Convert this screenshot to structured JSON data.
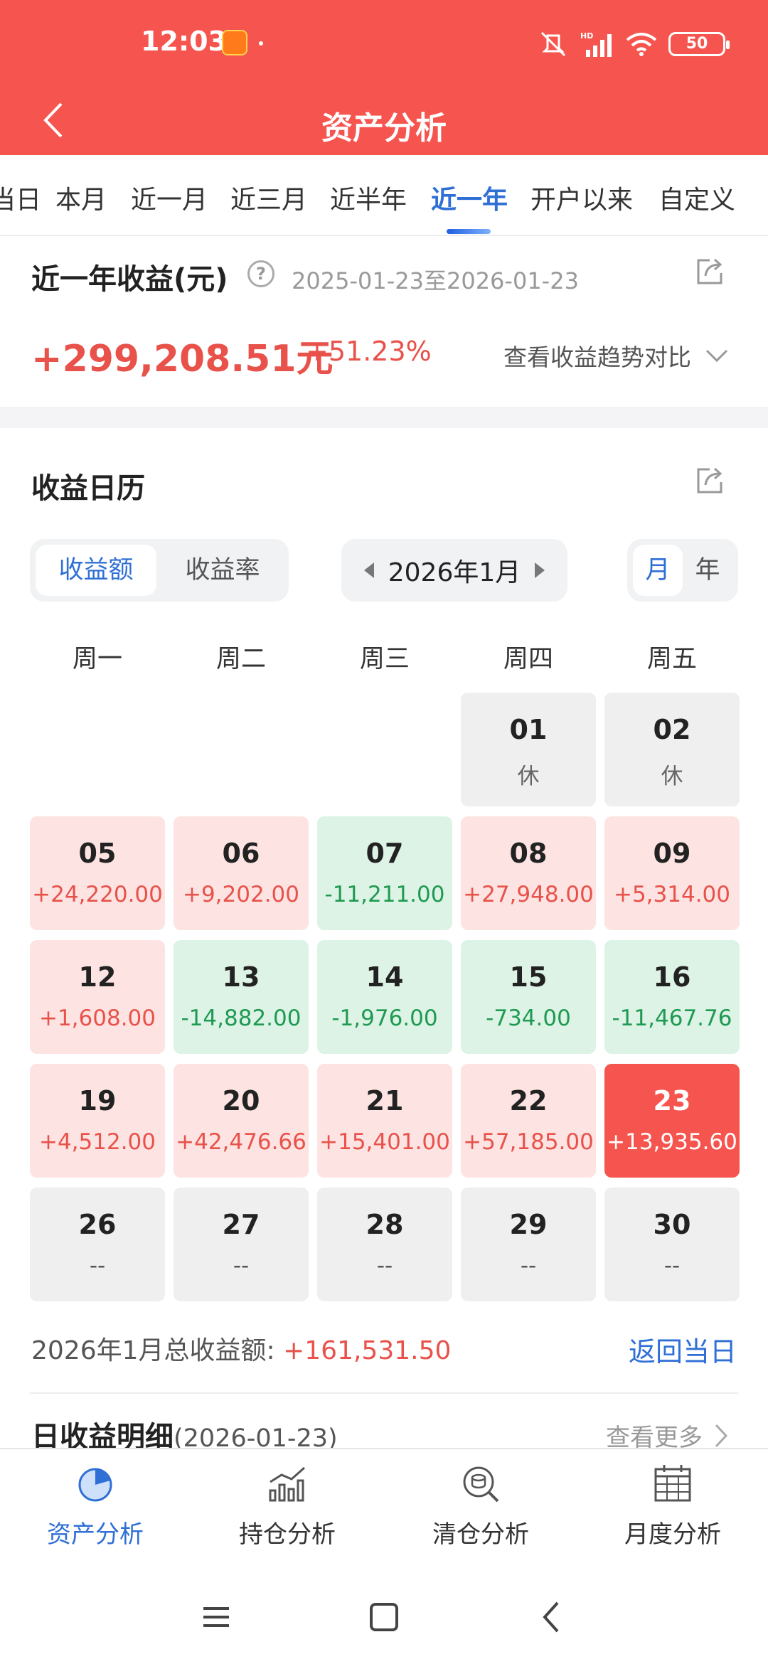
{
  "status": {
    "time": "12:03",
    "battery": "50"
  },
  "nav": {
    "title": "资产分析"
  },
  "period_tabs": [
    "当日",
    "本月",
    "近一月",
    "近三月",
    "近半年",
    "近一年",
    "开户以来",
    "自定义"
  ],
  "summary": {
    "title": "近一年收益(元)",
    "help": "?",
    "range": "2025-01-23至2026-01-23",
    "profit": "+299,208.51元",
    "rate": "+51.23%",
    "trend_link": "查看收益趋势对比"
  },
  "calendar": {
    "title": "收益日历",
    "metric_tabs": [
      "收益额",
      "收益率"
    ],
    "month_label": "2026年1月",
    "view_tabs": [
      "月",
      "年"
    ],
    "weekdays": [
      "周一",
      "周二",
      "周三",
      "周四",
      "周五"
    ],
    "rows": [
      [
        {
          "day": "",
          "value": "",
          "kind": "none"
        },
        {
          "day": "",
          "value": "",
          "kind": "none"
        },
        {
          "day": "",
          "value": "",
          "kind": "none"
        },
        {
          "day": "01",
          "value": "休",
          "kind": "rest"
        },
        {
          "day": "02",
          "value": "休",
          "kind": "rest"
        }
      ],
      [
        {
          "day": "05",
          "value": "+24,220.00",
          "kind": "up"
        },
        {
          "day": "06",
          "value": "+9,202.00",
          "kind": "up"
        },
        {
          "day": "07",
          "value": "-11,211.00",
          "kind": "down"
        },
        {
          "day": "08",
          "value": "+27,948.00",
          "kind": "up"
        },
        {
          "day": "09",
          "value": "+5,314.00",
          "kind": "up"
        }
      ],
      [
        {
          "day": "12",
          "value": "+1,608.00",
          "kind": "up"
        },
        {
          "day": "13",
          "value": "-14,882.00",
          "kind": "down"
        },
        {
          "day": "14",
          "value": "-1,976.00",
          "kind": "down"
        },
        {
          "day": "15",
          "value": "-734.00",
          "kind": "down"
        },
        {
          "day": "16",
          "value": "-11,467.76",
          "kind": "down"
        }
      ],
      [
        {
          "day": "19",
          "value": "+4,512.00",
          "kind": "up"
        },
        {
          "day": "20",
          "value": "+42,476.66",
          "kind": "up"
        },
        {
          "day": "21",
          "value": "+15,401.00",
          "kind": "up"
        },
        {
          "day": "22",
          "value": "+57,185.00",
          "kind": "up"
        },
        {
          "day": "23",
          "value": "+13,935.60",
          "kind": "today"
        }
      ],
      [
        {
          "day": "26",
          "value": "--",
          "kind": "empty"
        },
        {
          "day": "27",
          "value": "--",
          "kind": "empty"
        },
        {
          "day": "28",
          "value": "--",
          "kind": "empty"
        },
        {
          "day": "29",
          "value": "--",
          "kind": "empty"
        },
        {
          "day": "30",
          "value": "--",
          "kind": "empty"
        }
      ]
    ],
    "month_total_label": "2026年1月总收益额:",
    "month_total_value": "+161,531.50",
    "back_today": "返回当日",
    "detail_title": "日收益明细",
    "detail_date": "(2026-01-23)",
    "see_more": "查看更多"
  },
  "bottom_tabs": [
    {
      "label": "资产分析",
      "icon": "pie-chart-icon"
    },
    {
      "label": "持仓分析",
      "icon": "bar-trend-icon"
    },
    {
      "label": "清仓分析",
      "icon": "coin-search-icon"
    },
    {
      "label": "月度分析",
      "icon": "calendar-grid-icon"
    }
  ],
  "colors": {
    "brand_red": "#f6554f",
    "accent_blue": "#2f6fd6",
    "up": "#e8524a",
    "down": "#1f9a52"
  }
}
